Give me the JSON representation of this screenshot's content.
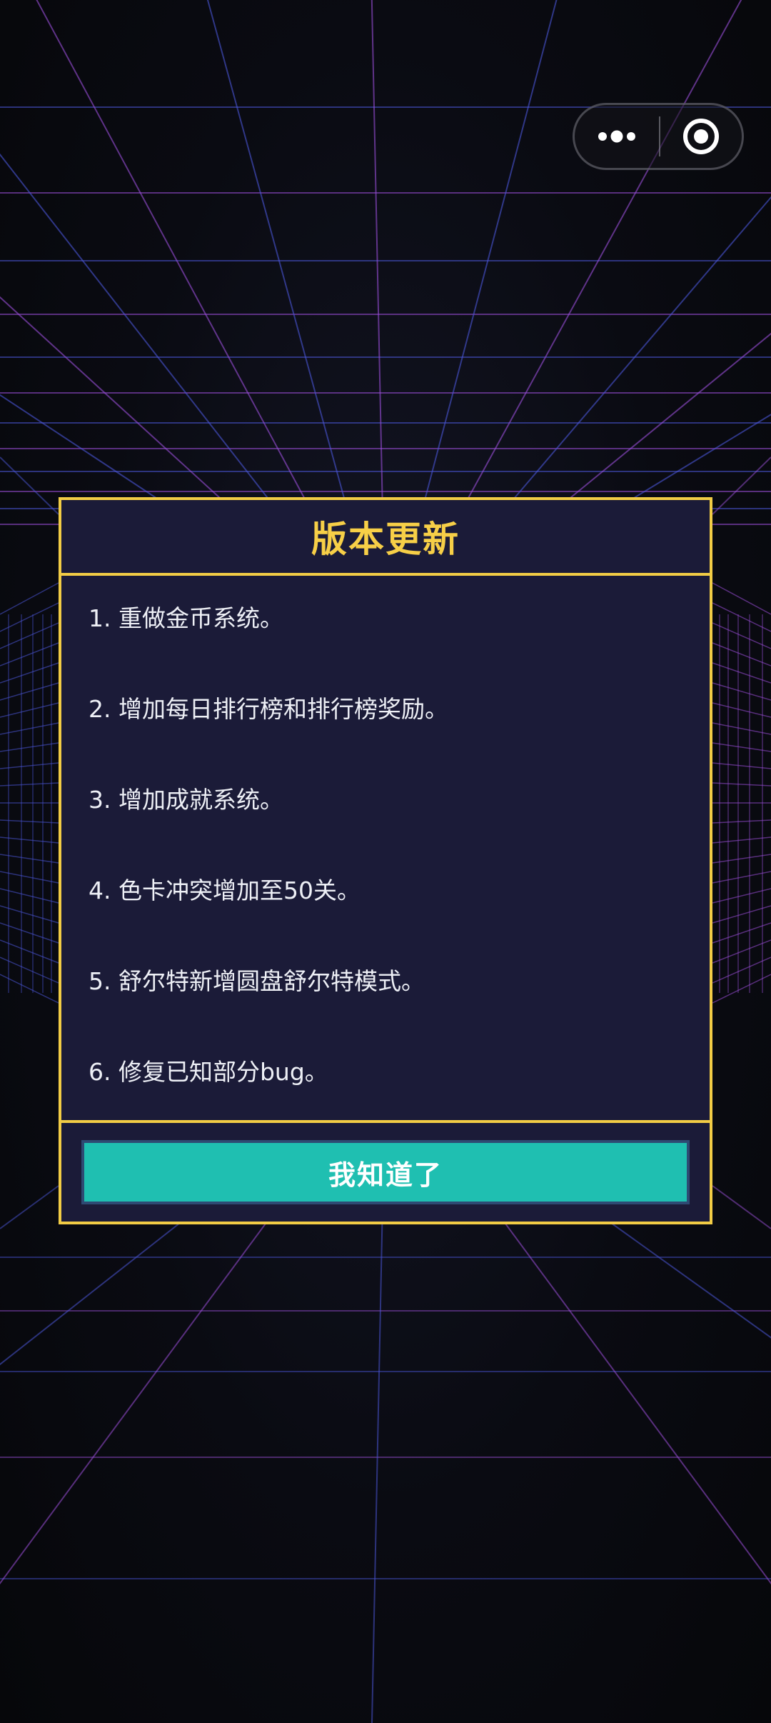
{
  "capsule": {
    "more_icon": "more-dots-icon",
    "close_icon": "target-circle-icon"
  },
  "dialog": {
    "title": "版本更新",
    "notes": [
      "1. 重做金币系统。",
      "2. 增加每日排行榜和排行榜奖励。",
      "3. 增加成就系统。",
      "4. 色卡冲突增加至50关。",
      "5. 舒尔特新增圆盘舒尔特模式。",
      "6. 修复已知部分bug。"
    ],
    "confirm_label": "我知道了"
  },
  "colors": {
    "accent_border": "#f2cc45",
    "title": "#f7cf47",
    "dialog_bg": "#1b1b38",
    "button": "#1fbfb1",
    "grid_blue": "#4a55d6",
    "grid_purple": "#9a4fd8"
  }
}
